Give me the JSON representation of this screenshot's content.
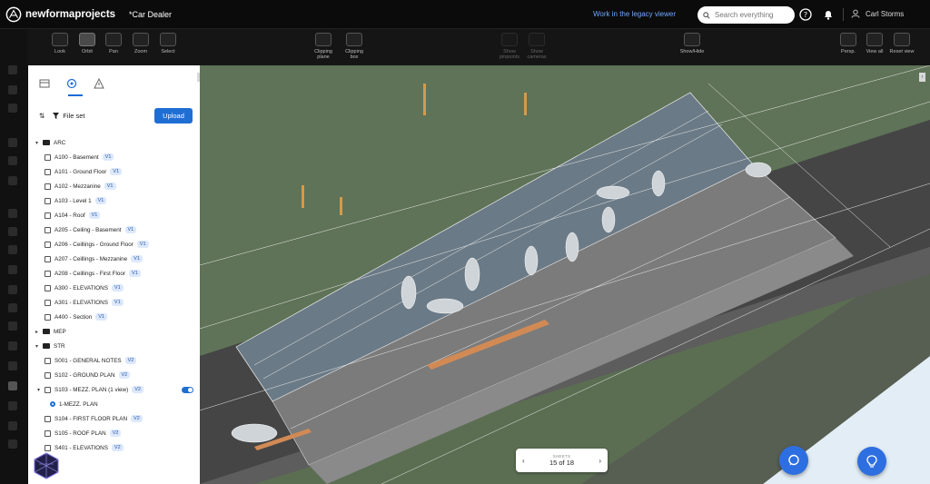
{
  "header": {
    "logo_text": "newformaprojects",
    "doc_title": "*Car Dealer",
    "legacy_link": "Work in the legacy viewer",
    "search_placeholder": "Search everything",
    "user_name": "Carl Storms"
  },
  "toolbar": {
    "look": "Look",
    "orbit": "Orbit",
    "pan": "Pan",
    "zoom": "Zoom",
    "select": "Select",
    "clipping_plane": "Clipping plane",
    "clipping_box": "Clipping box",
    "show_pinpoints": "Show pinpoints",
    "show_cameras": "Show cameras",
    "show_hide": "Show/Hide",
    "persp": "Persp.",
    "view_all": "View all",
    "reset_view": "Reset view"
  },
  "panel": {
    "file_set": "File set",
    "upload": "Upload",
    "tree": [
      {
        "type": "folder",
        "label": "ARC"
      },
      {
        "type": "sheet",
        "label": "A100 - Basement",
        "badge": "V1"
      },
      {
        "type": "sheet",
        "label": "A101 - Ground Floor",
        "badge": "V1"
      },
      {
        "type": "sheet",
        "label": "A102 - Mezzanine",
        "badge": "V1"
      },
      {
        "type": "sheet",
        "label": "A103 - Level 1",
        "badge": "V1"
      },
      {
        "type": "sheet",
        "label": "A104 - Roof",
        "badge": "V1"
      },
      {
        "type": "sheet",
        "label": "A205 - Ceiling - Basement",
        "badge": "V1"
      },
      {
        "type": "sheet",
        "label": "A206 - Ceillings - Ground Floor",
        "badge": "V1"
      },
      {
        "type": "sheet",
        "label": "A207 - Ceillings - Mezzanine",
        "badge": "V1"
      },
      {
        "type": "sheet",
        "label": "A208 - Ceillings - First Floor",
        "badge": "V1"
      },
      {
        "type": "sheet",
        "label": "A300 - ELEVATIONS",
        "badge": "V1"
      },
      {
        "type": "sheet",
        "label": "A301 - ELEVATIONS",
        "badge": "V1"
      },
      {
        "type": "sheet",
        "label": "A400 - Section",
        "badge": "V1"
      },
      {
        "type": "folder-collapsed",
        "label": "MEP"
      },
      {
        "type": "folder",
        "label": "STR"
      },
      {
        "type": "sheet",
        "label": "S001 - GENERAL NOTES",
        "badge": "V2"
      },
      {
        "type": "sheet",
        "label": "S102 - GROUND PLAN",
        "badge": "V2"
      },
      {
        "type": "sheet-expanded",
        "label": "S103 - MEZZ. PLAN (1 view)",
        "badge": "V2"
      },
      {
        "type": "view",
        "label": "1-MEZZ. PLAN"
      },
      {
        "type": "sheet",
        "label": "S104 - FIRST FLOOR PLAN",
        "badge": "V2"
      },
      {
        "type": "sheet",
        "label": "S105 - ROOF PLAN",
        "badge": "V2"
      },
      {
        "type": "sheet",
        "label": "S401 - ELEVATIONS",
        "badge": "V2"
      }
    ]
  },
  "sheets": {
    "label": "SHEETS",
    "count": "15 of 18",
    "prev": "‹",
    "next": "›"
  },
  "colors": {
    "accent": "#1f6ed4",
    "fab": "#2d6fe0"
  },
  "icons": [
    "search-icon",
    "help-icon",
    "bell-icon",
    "user-icon",
    "chat-icon",
    "lightbulb-icon"
  ]
}
